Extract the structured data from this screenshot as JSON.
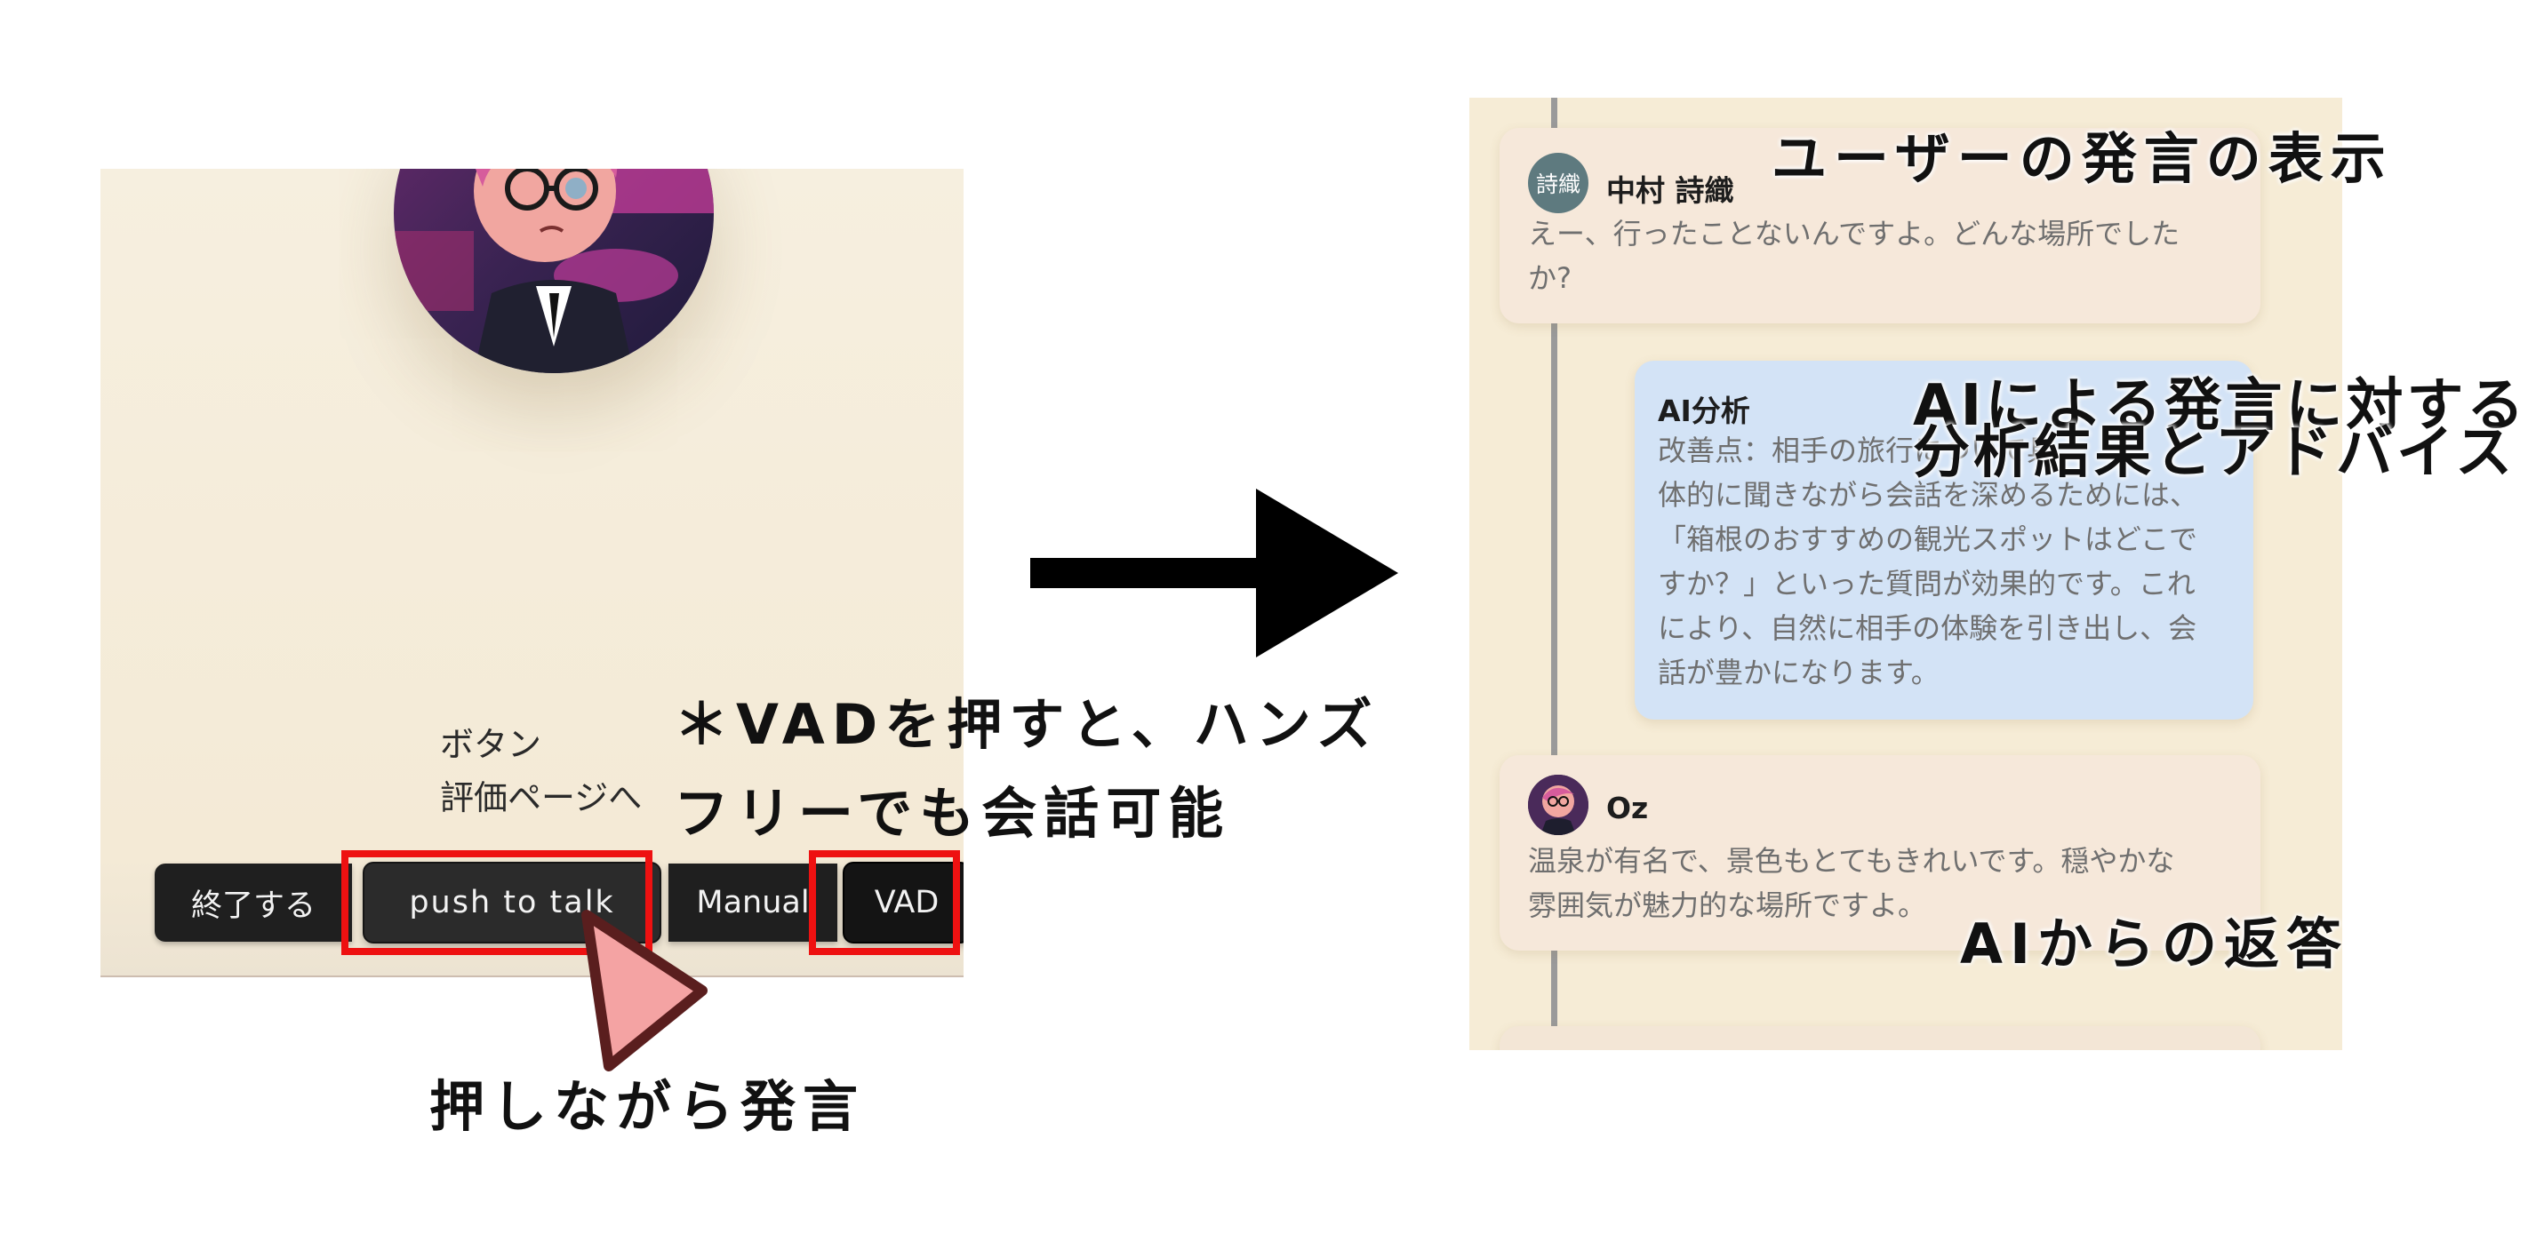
{
  "call_screen": {
    "bg_color": "#f6efdf",
    "partner_avatar": "ai-character-portrait",
    "hidden_labels": {
      "button": "ボタン",
      "to_evaluation": "評価ページへ"
    },
    "controls": {
      "end": "終了する",
      "push_to_talk": "push to talk",
      "manual": "Manual",
      "vad": "VAD"
    }
  },
  "annotations": {
    "vad_note_line1": "＊VADを押すと、ハンズ",
    "vad_note_line2": "フリーでも会話可能",
    "push_note": "押しながら発言",
    "user_msg_note": "ユーザーの発言の表示",
    "ai_analysis_note_line1": "AIによる発言に対する",
    "ai_analysis_note_line2": "分析結果とアドバイス",
    "ai_reply_note": "AIからの返答",
    "highlight_color": "#ee1111",
    "cursor_color": "#f4a3a3"
  },
  "chat": {
    "bg_color": "#f6ecd6",
    "messages": [
      {
        "avatar_text": "詩織",
        "speaker": "中村 詩織",
        "text_line1": "えー、行ったことないんですよ。どんな場所でした",
        "text_line2": "か?"
      },
      {
        "speaker": "AI分析",
        "text_lines": [
          "改善点：相手の旅行について具",
          "体的に聞きながら会話を深めるためには、",
          "「箱根のおすすめの観光スポットはどこで",
          "すか？」といった質問が効果的です。これ",
          "により、自然に相手の体験を引き出し、会",
          "話が豊かになります。"
        ],
        "bubble_color": "#d3e3f6"
      },
      {
        "avatar": "oz-avatar-icon",
        "speaker": "Oz",
        "text_line1": "温泉が有名で、景色もとてもきれいです。穏やかな",
        "text_line2": "雰囲気が魅力的な場所ですよ。"
      }
    ]
  }
}
